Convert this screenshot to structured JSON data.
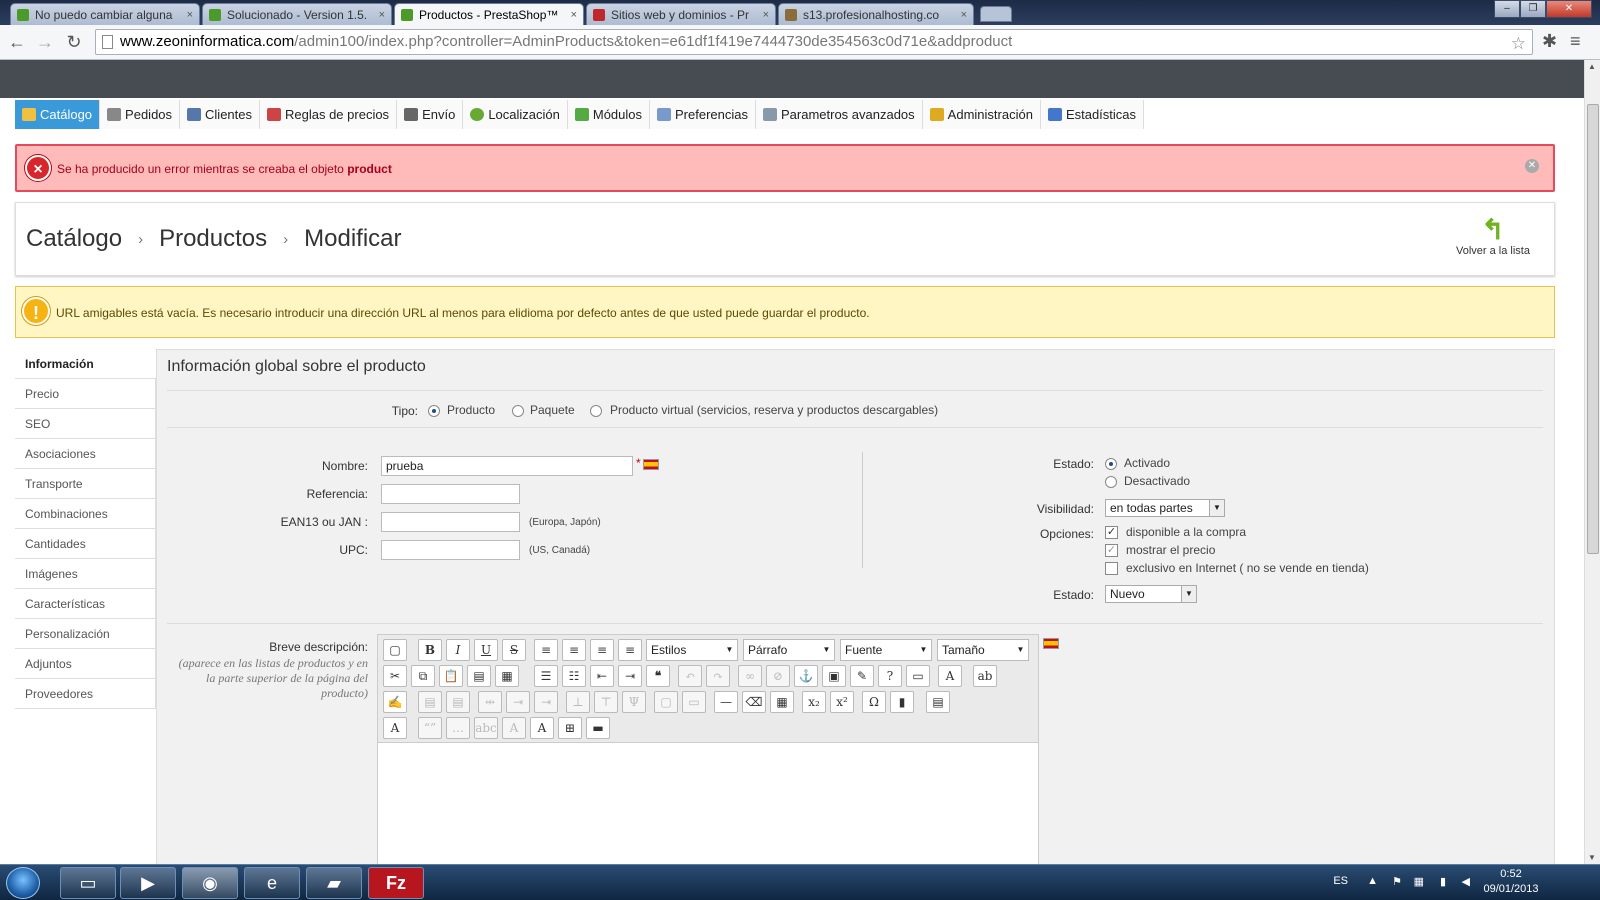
{
  "browser": {
    "tabs": [
      {
        "label": "No puedo cambiar alguna",
        "favicon_color": "#4c9a2a",
        "active": false
      },
      {
        "label": "Solucionado - Version 1.5.",
        "favicon_color": "#4c9a2a",
        "active": false
      },
      {
        "label": "Productos - PrestaShop™",
        "favicon_color": "#4c9a2a",
        "active": true
      },
      {
        "label": "Sitios web y dominios - Pr",
        "favicon_color": "#c0272d",
        "active": false
      },
      {
        "label": "s13.profesionalhosting.co",
        "favicon_color": "#8a6d3b",
        "active": false
      }
    ],
    "tab_close": "×",
    "url_host": "www.zeoninformatica.com",
    "url_path": "/admin100/index.php?controller=AdminProducts&token=e61df1f419e7444730de354563c0d71e&addproduct",
    "icons": [
      "back-icon",
      "forward-icon",
      "reload-icon",
      "star-icon",
      "extension-icon",
      "menu-icon"
    ]
  },
  "admin_menu": [
    {
      "label": "Catálogo",
      "icon_color": "#f0c040",
      "active": true
    },
    {
      "label": "Pedidos",
      "icon_color": "#888888"
    },
    {
      "label": "Clientes",
      "icon_color": "#5577aa"
    },
    {
      "label": "Reglas de precios",
      "icon_color": "#cc4444"
    },
    {
      "label": "Envío",
      "icon_color": "#666666"
    },
    {
      "label": "Localización",
      "icon_color": "#66aa33"
    },
    {
      "label": "Módulos",
      "icon_color": "#55aa44"
    },
    {
      "label": "Preferencias",
      "icon_color": "#7799cc"
    },
    {
      "label": "Parametros avanzados",
      "icon_color": "#8899aa"
    },
    {
      "label": "Administración",
      "icon_color": "#ddaa22"
    },
    {
      "label": "Estadísticas",
      "icon_color": "#4477cc"
    }
  ],
  "error": {
    "text": "Se ha producido un error mientras se creaba el objeto",
    "object": "product",
    "icon": "×"
  },
  "breadcrumb": {
    "items": [
      "Catálogo",
      "Productos",
      "Modificar"
    ],
    "separator": "›",
    "back_label": "Volver a la lista",
    "back_icon": "↰"
  },
  "warning": {
    "icon": "!",
    "text": "URL amigables está vacía. Es necesario introducir una dirección URL al menos para elidioma por defecto antes de que usted puede guardar el producto."
  },
  "product_tabs": [
    "Información",
    "Precio",
    "SEO",
    "Asociaciones",
    "Transporte",
    "Combinaciones",
    "Cantidades",
    "Imágenes",
    "Características",
    "Personalización",
    "Adjuntos",
    "Proveedores"
  ],
  "form": {
    "title": "Información global sobre el producto",
    "tipo_label": "Tipo:",
    "tipo_options": [
      "Producto",
      "Paquete",
      "Producto virtual (servicios, reserva y productos descargables)"
    ],
    "tipo_selected": "Producto",
    "nombre_label": "Nombre:",
    "nombre_value": "prueba",
    "required_mark": "*",
    "referencia_label": "Referencia:",
    "ean_label": "EAN13 ou JAN :",
    "ean_hint": "(Europa, Japón)",
    "upc_label": "UPC:",
    "upc_hint": "(US, Canadá)",
    "estado_label": "Estado:",
    "estado_options": [
      "Activado",
      "Desactivado"
    ],
    "estado_selected": "Activado",
    "visibilidad_label": "Visibilidad:",
    "visibilidad_value": "en todas partes",
    "opciones_label": "Opciones:",
    "opciones": [
      {
        "label": "disponible a la compra",
        "checked": true
      },
      {
        "label": "mostrar el precio",
        "checked": true
      },
      {
        "label": "exclusivo en Internet ( no se vende en tienda)",
        "checked": false
      }
    ],
    "condicion_label": "Estado:",
    "condicion_value": "Nuevo",
    "breve_label": "Breve descripción:",
    "breve_hint": "(aparece en las listas de productos y en la parte superior de la página del producto)"
  },
  "editor": {
    "selects": [
      "Estilos",
      "Párrafo",
      "Fuente",
      "Tamaño"
    ],
    "buttons_row1": [
      "B",
      "I",
      "U",
      "S"
    ]
  },
  "taskbar": {
    "lang": "ES",
    "time": "0:52",
    "date": "09/01/2013"
  }
}
